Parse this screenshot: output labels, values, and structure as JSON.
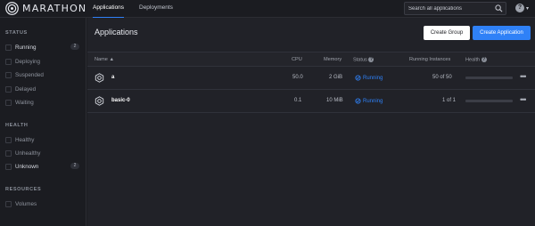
{
  "brand": {
    "name": "MARATHON"
  },
  "nav": {
    "tabs": [
      {
        "label": "Applications",
        "active": true
      },
      {
        "label": "Deployments",
        "active": false
      }
    ]
  },
  "search": {
    "placeholder": "Search all applications",
    "value": ""
  },
  "help": {
    "label": "?"
  },
  "sidebar": {
    "status_heading": "STATUS",
    "status_items": [
      {
        "label": "Running",
        "count": "2"
      },
      {
        "label": "Deploying"
      },
      {
        "label": "Suspended"
      },
      {
        "label": "Delayed"
      },
      {
        "label": "Waiting"
      }
    ],
    "health_heading": "HEALTH",
    "health_items": [
      {
        "label": "Healthy"
      },
      {
        "label": "Unhealthy"
      },
      {
        "label": "Unknown",
        "count": "2"
      }
    ],
    "resources_heading": "RESOURCES",
    "resources_items": [
      {
        "label": "Volumes"
      }
    ]
  },
  "main": {
    "title": "Applications",
    "create_group_label": "Create Group",
    "create_app_label": "Create Application"
  },
  "table": {
    "columns": {
      "name": "Name ▲",
      "cpu": "CPU",
      "memory": "Memory",
      "status": "Status",
      "instances": "Running Instances",
      "health": "Health"
    },
    "rows": [
      {
        "name": "a",
        "cpu": "50.0",
        "memory": "2 GiB",
        "status": "Running",
        "instances": "50 of 50",
        "health_fraction": 0
      },
      {
        "name": "basic-0",
        "cpu": "0.1",
        "memory": "10 MiB",
        "status": "Running",
        "instances": "1 of 1",
        "health_fraction": 0
      }
    ]
  },
  "colors": {
    "accent": "#2f81f7",
    "background": "#1b1c21",
    "panel": "#212228"
  }
}
